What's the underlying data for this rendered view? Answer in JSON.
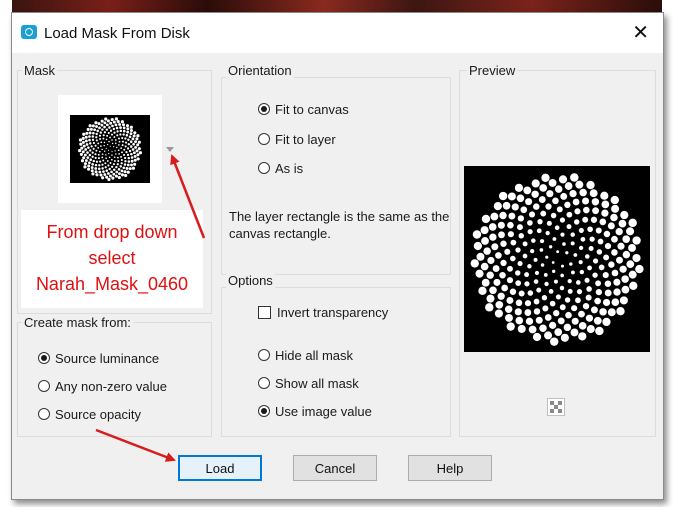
{
  "window": {
    "title": "Load Mask From Disk",
    "close_symbol": "✕"
  },
  "mask": {
    "group_label": "Mask",
    "annotation": [
      "From drop down",
      "select",
      "Narah_Mask_0460"
    ]
  },
  "create_from": {
    "group_label": "Create mask from:",
    "options": [
      "Source luminance",
      "Any non-zero value",
      "Source opacity"
    ],
    "selected": 0
  },
  "orientation": {
    "group_label": "Orientation",
    "options": [
      "Fit to canvas",
      "Fit to layer",
      "As is"
    ],
    "selected": 0,
    "description": "The layer rectangle is the same as the canvas rectangle."
  },
  "options": {
    "group_label": "Options",
    "invert_label": "Invert transparency",
    "invert_checked": false,
    "radios": [
      "Hide all mask",
      "Show all mask",
      "Use image value"
    ],
    "selected": 2
  },
  "preview": {
    "group_label": "Preview"
  },
  "buttons": {
    "load": "Load",
    "cancel": "Cancel",
    "help": "Help"
  },
  "colors": {
    "accent": "#0078d7",
    "annotation": "#e01010",
    "arrow": "#d81b1b"
  }
}
